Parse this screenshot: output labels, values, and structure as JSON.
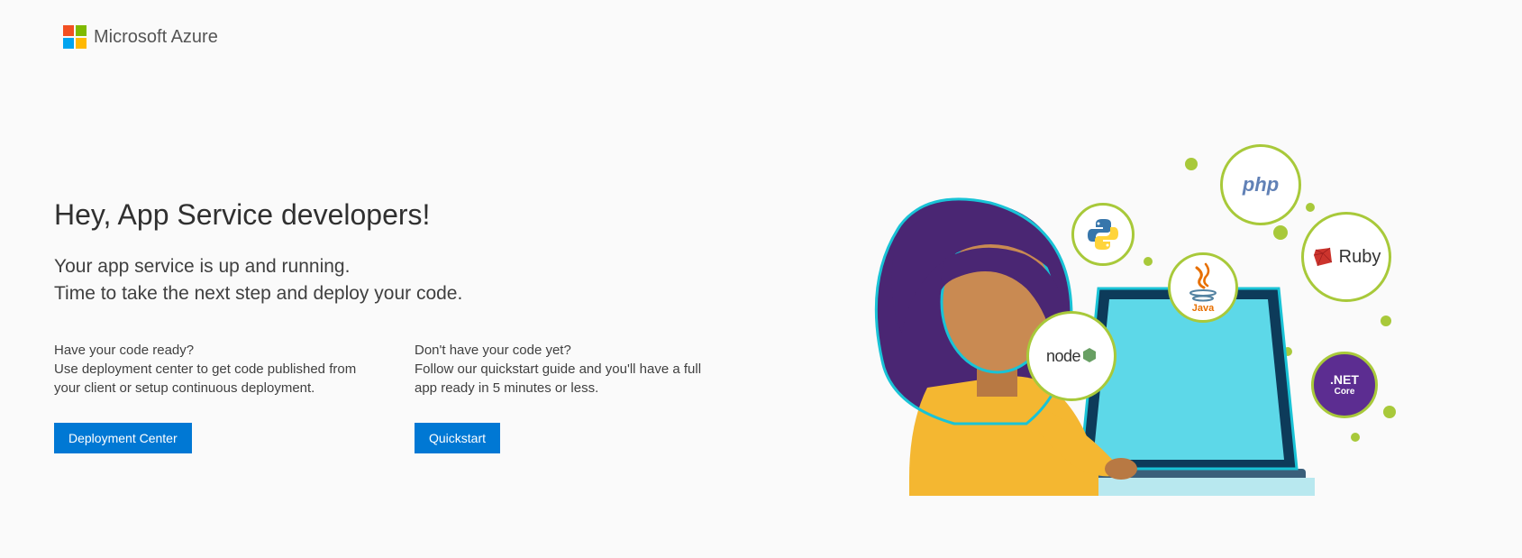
{
  "header": {
    "brand": "Microsoft Azure"
  },
  "main": {
    "headline": "Hey, App Service developers!",
    "subline_1": "Your app service is up and running.",
    "subline_2": "Time to take the next step and deploy your code."
  },
  "columns": {
    "left": {
      "question": "Have your code ready?",
      "description": "Use deployment center to get code published from your client or setup continuous deployment.",
      "button_label": "Deployment Center"
    },
    "right": {
      "question": "Don't have your code yet?",
      "description": "Follow our quickstart guide and you'll have a full app ready in 5 minutes or less.",
      "button_label": "Quickstart"
    }
  },
  "illustration": {
    "bubbles": {
      "php": "php",
      "python": "python",
      "ruby": "Ruby",
      "java": "Java",
      "node": "node",
      "dotnet_line1": ".NET",
      "dotnet_line2": "Core"
    }
  }
}
